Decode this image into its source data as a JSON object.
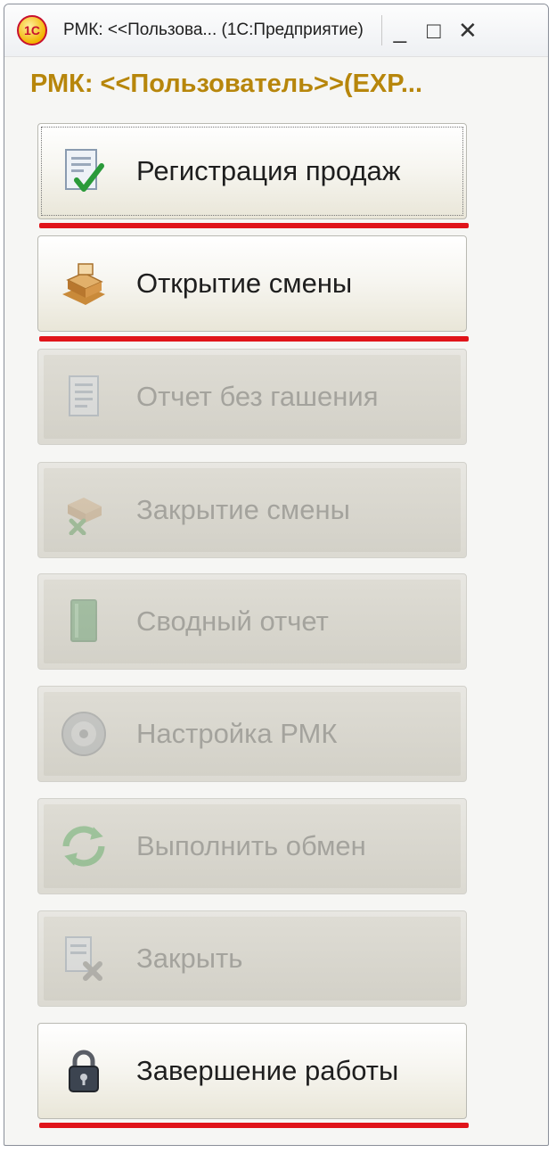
{
  "window": {
    "title": "РМК: <<Пользова... (1С:Предприятие)",
    "logo_text": "1С",
    "minimize_glyph": "_",
    "maximize_glyph": "□",
    "close_glyph": "✕"
  },
  "form": {
    "title": "РМК: <<Пользователь>>(EXP..."
  },
  "commands": [
    {
      "label": "Регистрация продаж",
      "icon": "sales-check-icon",
      "enabled": true,
      "highlighted": true
    },
    {
      "label": "Открытие смены",
      "icon": "cash-register-icon",
      "enabled": true,
      "highlighted": true
    },
    {
      "label": "Отчет без гашения",
      "icon": "report-document-icon",
      "enabled": false,
      "highlighted": false
    },
    {
      "label": "Закрытие смены",
      "icon": "close-shift-icon",
      "enabled": false,
      "highlighted": false
    },
    {
      "label": "Сводный отчет",
      "icon": "book-icon",
      "enabled": false,
      "highlighted": false
    },
    {
      "label": "Настройка РМК",
      "icon": "disc-settings-icon",
      "enabled": false,
      "highlighted": false
    },
    {
      "label": "Выполнить обмен",
      "icon": "sync-arrows-icon",
      "enabled": false,
      "highlighted": false
    },
    {
      "label": "Закрыть",
      "icon": "close-document-icon",
      "enabled": false,
      "highlighted": false
    },
    {
      "label": "Завершение работы",
      "icon": "lock-icon",
      "enabled": true,
      "highlighted": true
    }
  ],
  "colors": {
    "title_text": "#b7860b",
    "highlight_underline": "#e0141a",
    "disabled_text": "#a4a39d"
  }
}
